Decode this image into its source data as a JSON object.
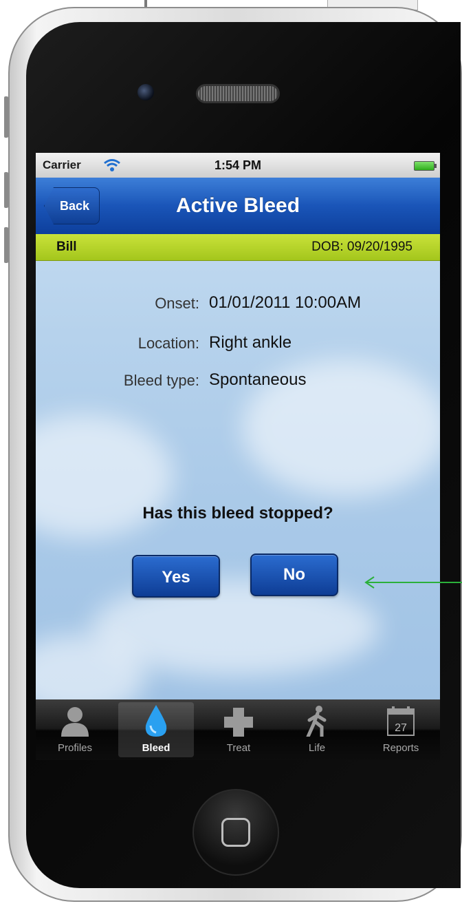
{
  "status_bar": {
    "carrier": "Carrier",
    "time": "1:54 PM"
  },
  "nav": {
    "back_label": "Back",
    "title": "Active Bleed"
  },
  "patient": {
    "name": "Bill",
    "dob": "DOB: 09/20/1995"
  },
  "details": [
    {
      "label": "Onset:",
      "value": "01/01/2011 10:00AM"
    },
    {
      "label": "Location:",
      "value": "Right ankle"
    },
    {
      "label": "Bleed type:",
      "value": "Spontaneous"
    }
  ],
  "question": "Has this bleed stopped?",
  "buttons": {
    "yes": "Yes",
    "no": "No"
  },
  "tabs": [
    {
      "label": "Profiles",
      "icon": "person-icon",
      "selected": false
    },
    {
      "label": "Bleed",
      "icon": "drop-icon",
      "selected": true
    },
    {
      "label": "Treat",
      "icon": "plus-icon",
      "selected": false
    },
    {
      "label": "Life",
      "icon": "walking-person-icon",
      "selected": false
    },
    {
      "label": "Reports",
      "icon": "calendar-icon",
      "selected": false,
      "calendar_day": "27"
    }
  ],
  "colors": {
    "nav_blue": "#1a55b8",
    "patient_bar_green": "#b5d42a",
    "button_blue": "#0e3d95",
    "annotation_arrow": "#2bb03a"
  }
}
